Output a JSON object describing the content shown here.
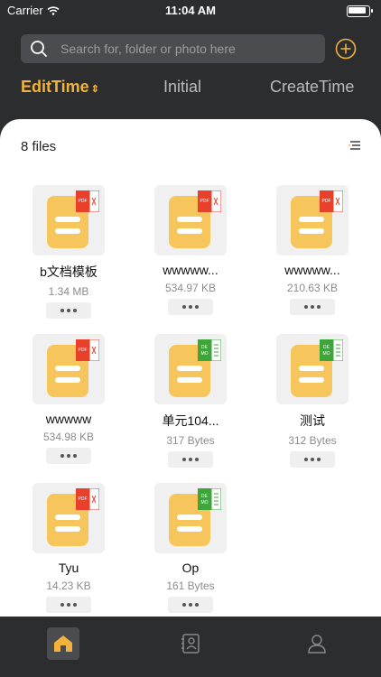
{
  "status": {
    "carrier": "Carrier",
    "time": "11:04 AM"
  },
  "search": {
    "placeholder": "Search for, folder or photo here"
  },
  "tabs": [
    {
      "label": "EditTime",
      "active": true
    },
    {
      "label": "Initial",
      "active": false
    },
    {
      "label": "CreateTime",
      "active": false
    }
  ],
  "file_count": "8 files",
  "files": [
    {
      "name": "b文档模板",
      "size": "1.34 MB",
      "type": "pdf"
    },
    {
      "name": "wwwww...",
      "size": "534.97 KB",
      "type": "pdf"
    },
    {
      "name": "wwwww...",
      "size": "210.63 KB",
      "type": "pdf"
    },
    {
      "name": "wwwww",
      "size": "534.98 KB",
      "type": "pdf"
    },
    {
      "name": "单元104...",
      "size": "317 Bytes",
      "type": "demo"
    },
    {
      "name": "测试",
      "size": "312 Bytes",
      "type": "demo"
    },
    {
      "name": "Tyu",
      "size": "14.23 KB",
      "type": "pdf"
    },
    {
      "name": "Op",
      "size": "161 Bytes",
      "type": "demo"
    }
  ],
  "badges": {
    "pdf": "PDF",
    "demo_top": "DE",
    "demo_bottom": "MO"
  },
  "colors": {
    "accent": "#f3b23c",
    "doc": "#f6c65c",
    "pdf": "#e8402b",
    "demo": "#3ea53a",
    "dark": "#2b2d2f"
  },
  "tabbar": {
    "items": [
      "home-icon",
      "contacts-icon",
      "profile-icon"
    ],
    "active": "home-icon"
  }
}
